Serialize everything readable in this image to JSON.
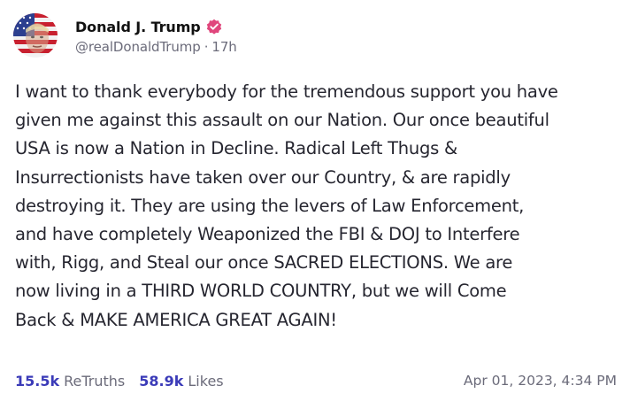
{
  "author": {
    "display_name": "Donald J. Trump",
    "handle": "@realDonaldTrump",
    "separator": "·",
    "age": "17h",
    "verified": true,
    "verified_color": "#e0467c",
    "avatar_icon": "flag-portrait-avatar"
  },
  "post": {
    "text": "I want to thank everybody for the tremendous support you have\ngiven me against this assault on our Nation. Our once beautiful\nUSA is now a Nation in Decline. Radical Left Thugs &\nInsurrectionists have taken over our Country, & are rapidly\ndestroying it. They are using the levers of Law Enforcement,\nand have completely Weaponized the FBI & DOJ to Interfere\nwith, Rigg, and Steal our once SACRED ELECTIONS. We are\nnow living in a THIRD WORLD COUNTRY, but we will Come\nBack & MAKE AMERICA GREAT AGAIN!"
  },
  "stats": {
    "retruths_count": "15.5k",
    "retruths_label": "ReTruths",
    "likes_count": "58.9k",
    "likes_label": "Likes",
    "accent_color": "#3b3bb8"
  },
  "timestamp": "Apr 01, 2023, 4:34 PM"
}
